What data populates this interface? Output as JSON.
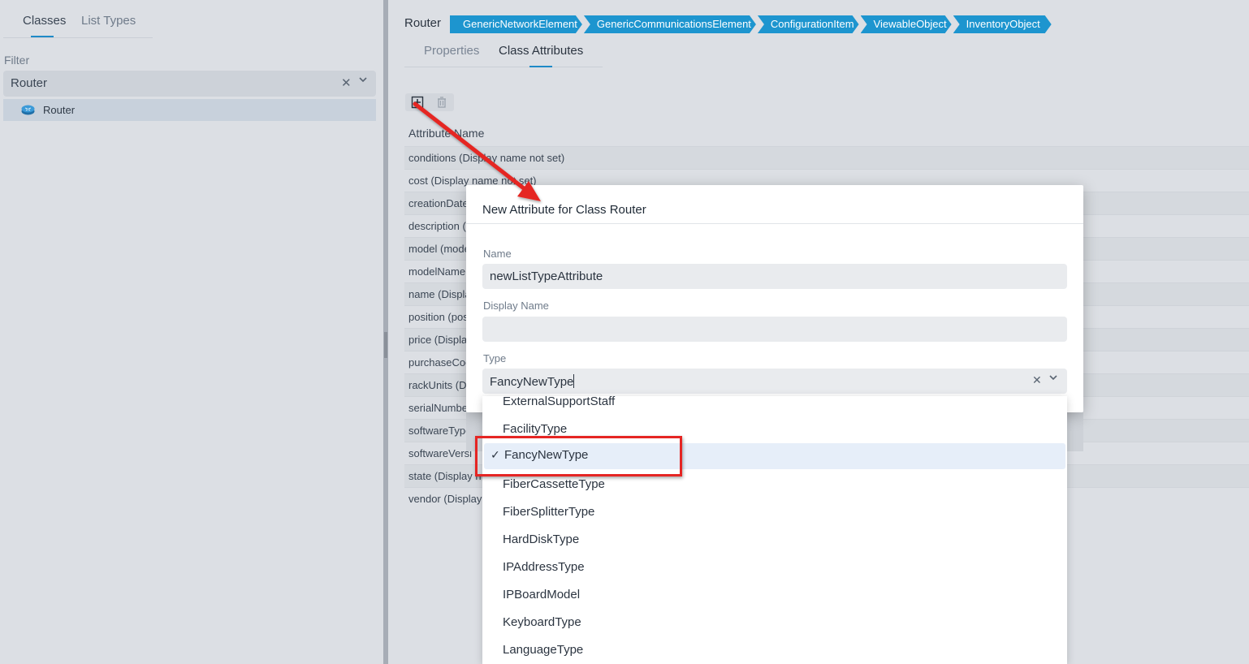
{
  "left_panel": {
    "tabs": [
      {
        "label": "Classes",
        "active": true
      },
      {
        "label": "List Types",
        "active": false
      }
    ],
    "filter_label": "Filter",
    "filter_value": "Router",
    "clear_icon": "✕",
    "chevron_icon": "⌵",
    "tree_items": [
      {
        "label": "Router",
        "icon": "router-icon",
        "selected": true
      }
    ]
  },
  "right_panel": {
    "class_name": "Router",
    "breadcrumb": [
      "GenericNetworkElement",
      "GenericCommunicationsElement",
      "ConfigurationItem",
      "ViewableObject",
      "InventoryObject"
    ],
    "tabs": [
      {
        "label": "Properties",
        "active": false
      },
      {
        "label": "Class Attributes",
        "active": true
      }
    ],
    "toolbar": {
      "add_icon": "add-icon",
      "delete_icon": "trash-icon"
    },
    "column_header": "Attribute Name",
    "attributes": [
      "conditions (Display name not set)",
      "cost (Display name not set)",
      "creationDate",
      "description (",
      "model (mode",
      "modelName",
      "name (Displa",
      "position (pos",
      "price (Display",
      "purchaseCod",
      "rackUnits (Di",
      "serialNumbe",
      "softwareType",
      "softwareVersi",
      "state (Display n",
      "vendor (Display n"
    ]
  },
  "dialog": {
    "title": "New Attribute for Class Router",
    "name_label": "Name",
    "name_value": "newListTypeAttribute",
    "display_name_label": "Display Name",
    "display_name_value": "",
    "type_label": "Type",
    "type_value": "FancyNewType",
    "clear_icon": "✕",
    "chevron_icon": "⌵"
  },
  "dropdown": {
    "check_icon": "✓",
    "options": [
      {
        "label": "ExternalSupportStaff",
        "selected": false
      },
      {
        "label": "FacilityType",
        "selected": false
      },
      {
        "label": "FancyNewType",
        "selected": true
      },
      {
        "label": "FiberCassetteType",
        "selected": false
      },
      {
        "label": "FiberSplitterType",
        "selected": false
      },
      {
        "label": "HardDiskType",
        "selected": false
      },
      {
        "label": "IPAddressType",
        "selected": false
      },
      {
        "label": "IPBoardModel",
        "selected": false
      },
      {
        "label": "KeyboardType",
        "selected": false
      },
      {
        "label": "LanguageType",
        "selected": false
      }
    ]
  },
  "colors": {
    "accent": "#1d95cf",
    "annotation": "#e52523",
    "selected_option_bg": "#e6eef9"
  }
}
